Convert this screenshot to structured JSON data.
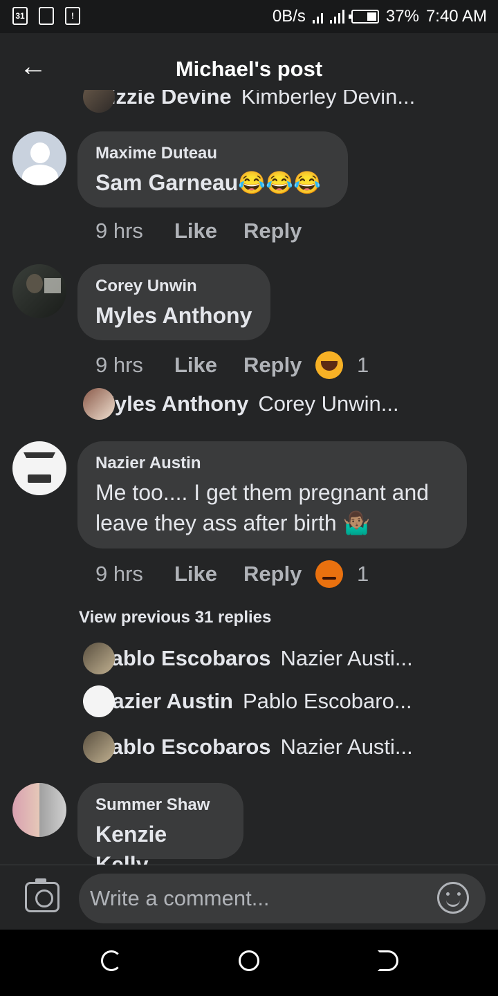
{
  "status_bar": {
    "notification_icons": [
      "calendar-icon",
      "screenshot-icon",
      "alert-icon"
    ],
    "calendar_date": "31",
    "net_speed": "0B/s",
    "battery": "37%",
    "battery_level": 0.37,
    "time": "7:40 AM"
  },
  "header": {
    "title": "Michael's post"
  },
  "comments": {
    "partial_reply": {
      "name": "Lizzie Devine",
      "snippet": "Kimberley Devin..."
    },
    "c1": {
      "author": "Maxime Duteau",
      "text": "Sam Garneau😂😂😂",
      "time": "9 hrs",
      "like": "Like",
      "reply": "Reply"
    },
    "c2": {
      "author": "Corey Unwin",
      "text": "Myles Anthony",
      "time": "9 hrs",
      "like": "Like",
      "reply": "Reply",
      "reaction_icon": "laughing-emoji-icon",
      "reaction_count": "1",
      "reply_preview": {
        "name": "Myles Anthony",
        "snippet": "Corey Unwin..."
      }
    },
    "c3": {
      "author": "Nazier Austin",
      "text_line1": "Me too.... I get them pregnant and",
      "text_line2": "leave they ass after birth 🤷🏽‍♂️",
      "time": "9 hrs",
      "like": "Like",
      "reply": "Reply",
      "reaction_icon": "angry-emoji-icon",
      "reaction_count": "1",
      "view_previous": "View previous 31 replies",
      "replies": [
        {
          "name": "Pablo Escobaros",
          "snippet": "Nazier Austi..."
        },
        {
          "name": "Nazier Austin",
          "snippet": "Pablo Escobaro..."
        },
        {
          "name": "Pablo Escobaros",
          "snippet": "Nazier Austi..."
        }
      ]
    },
    "c4": {
      "author": "Summer Shaw",
      "text": "Kenzie Kelly"
    }
  },
  "composer": {
    "placeholder": "Write a comment..."
  },
  "colors": {
    "background": "#242526",
    "bubble": "#3a3b3c",
    "text": "#e4e6eb",
    "muted": "#b0b3b8",
    "laugh": "#f7b125",
    "angry": "#e9710f"
  }
}
